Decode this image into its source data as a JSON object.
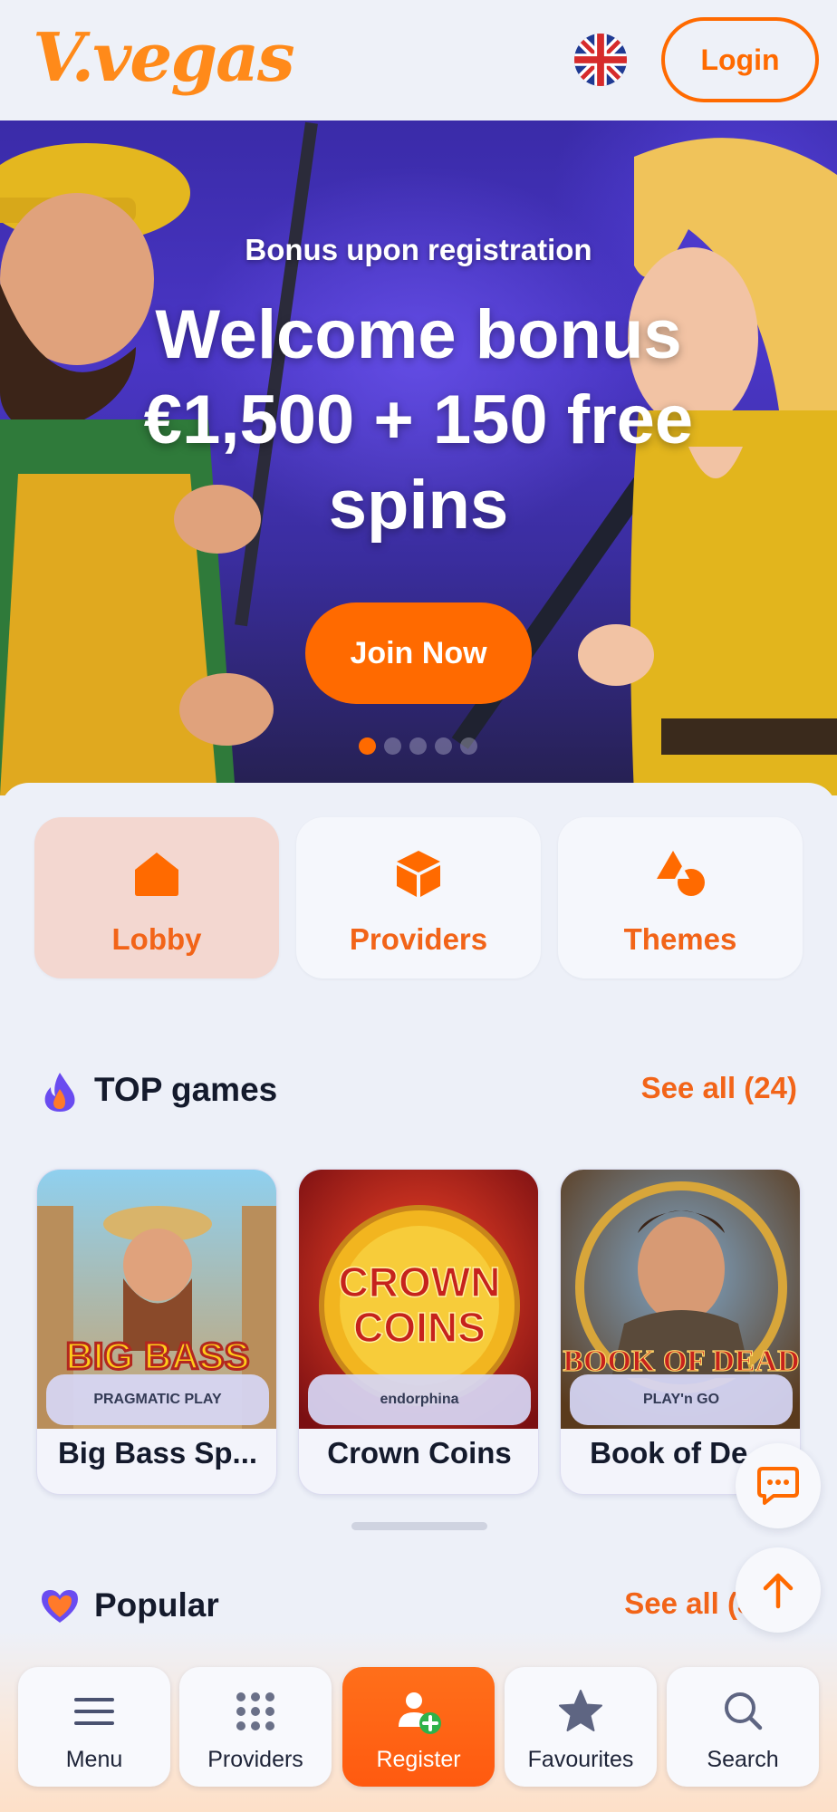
{
  "header": {
    "logo_text": "V.vegas",
    "language": "English (UK flag)",
    "login_label": "Login"
  },
  "hero": {
    "subtitle": "Bonus upon registration",
    "title": "Welcome bonus €1,500 + 150 free spins",
    "cta_label": "Join Now",
    "slides_total": 5,
    "slide_active": 1
  },
  "categories": [
    {
      "label": "Lobby",
      "icon": "home-icon",
      "active": true
    },
    {
      "label": "Providers",
      "icon": "cube-icon",
      "active": false
    },
    {
      "label": "Themes",
      "icon": "shapes-icon",
      "active": false
    }
  ],
  "top_games": {
    "title": "TOP games",
    "see_all": "See all (24)",
    "games": [
      {
        "name": "Big Bass Sp...",
        "provider": "PRAGMATIC PLAY",
        "thumb_text": "BIG BASS"
      },
      {
        "name": "Crown Coins",
        "provider": "endorphina",
        "thumb_text": "CROWN COINS"
      },
      {
        "name": "Book of De...",
        "provider": "PLAY'n GO",
        "thumb_text": "BOOK OF DEAD"
      }
    ]
  },
  "popular": {
    "title": "Popular",
    "see_all": "See all (310)"
  },
  "bottom_nav": [
    {
      "label": "Menu",
      "icon": "hamburger-icon"
    },
    {
      "label": "Providers",
      "icon": "grid-icon"
    },
    {
      "label": "Register",
      "icon": "add-user-icon",
      "primary": true
    },
    {
      "label": "Favourites",
      "icon": "star-icon"
    },
    {
      "label": "Search",
      "icon": "search-icon"
    }
  ],
  "colors": {
    "accent": "#ff6a00",
    "accent_text": "#f26418",
    "background": "#edf0f8",
    "active_category_bg": "#f3d7d0"
  }
}
